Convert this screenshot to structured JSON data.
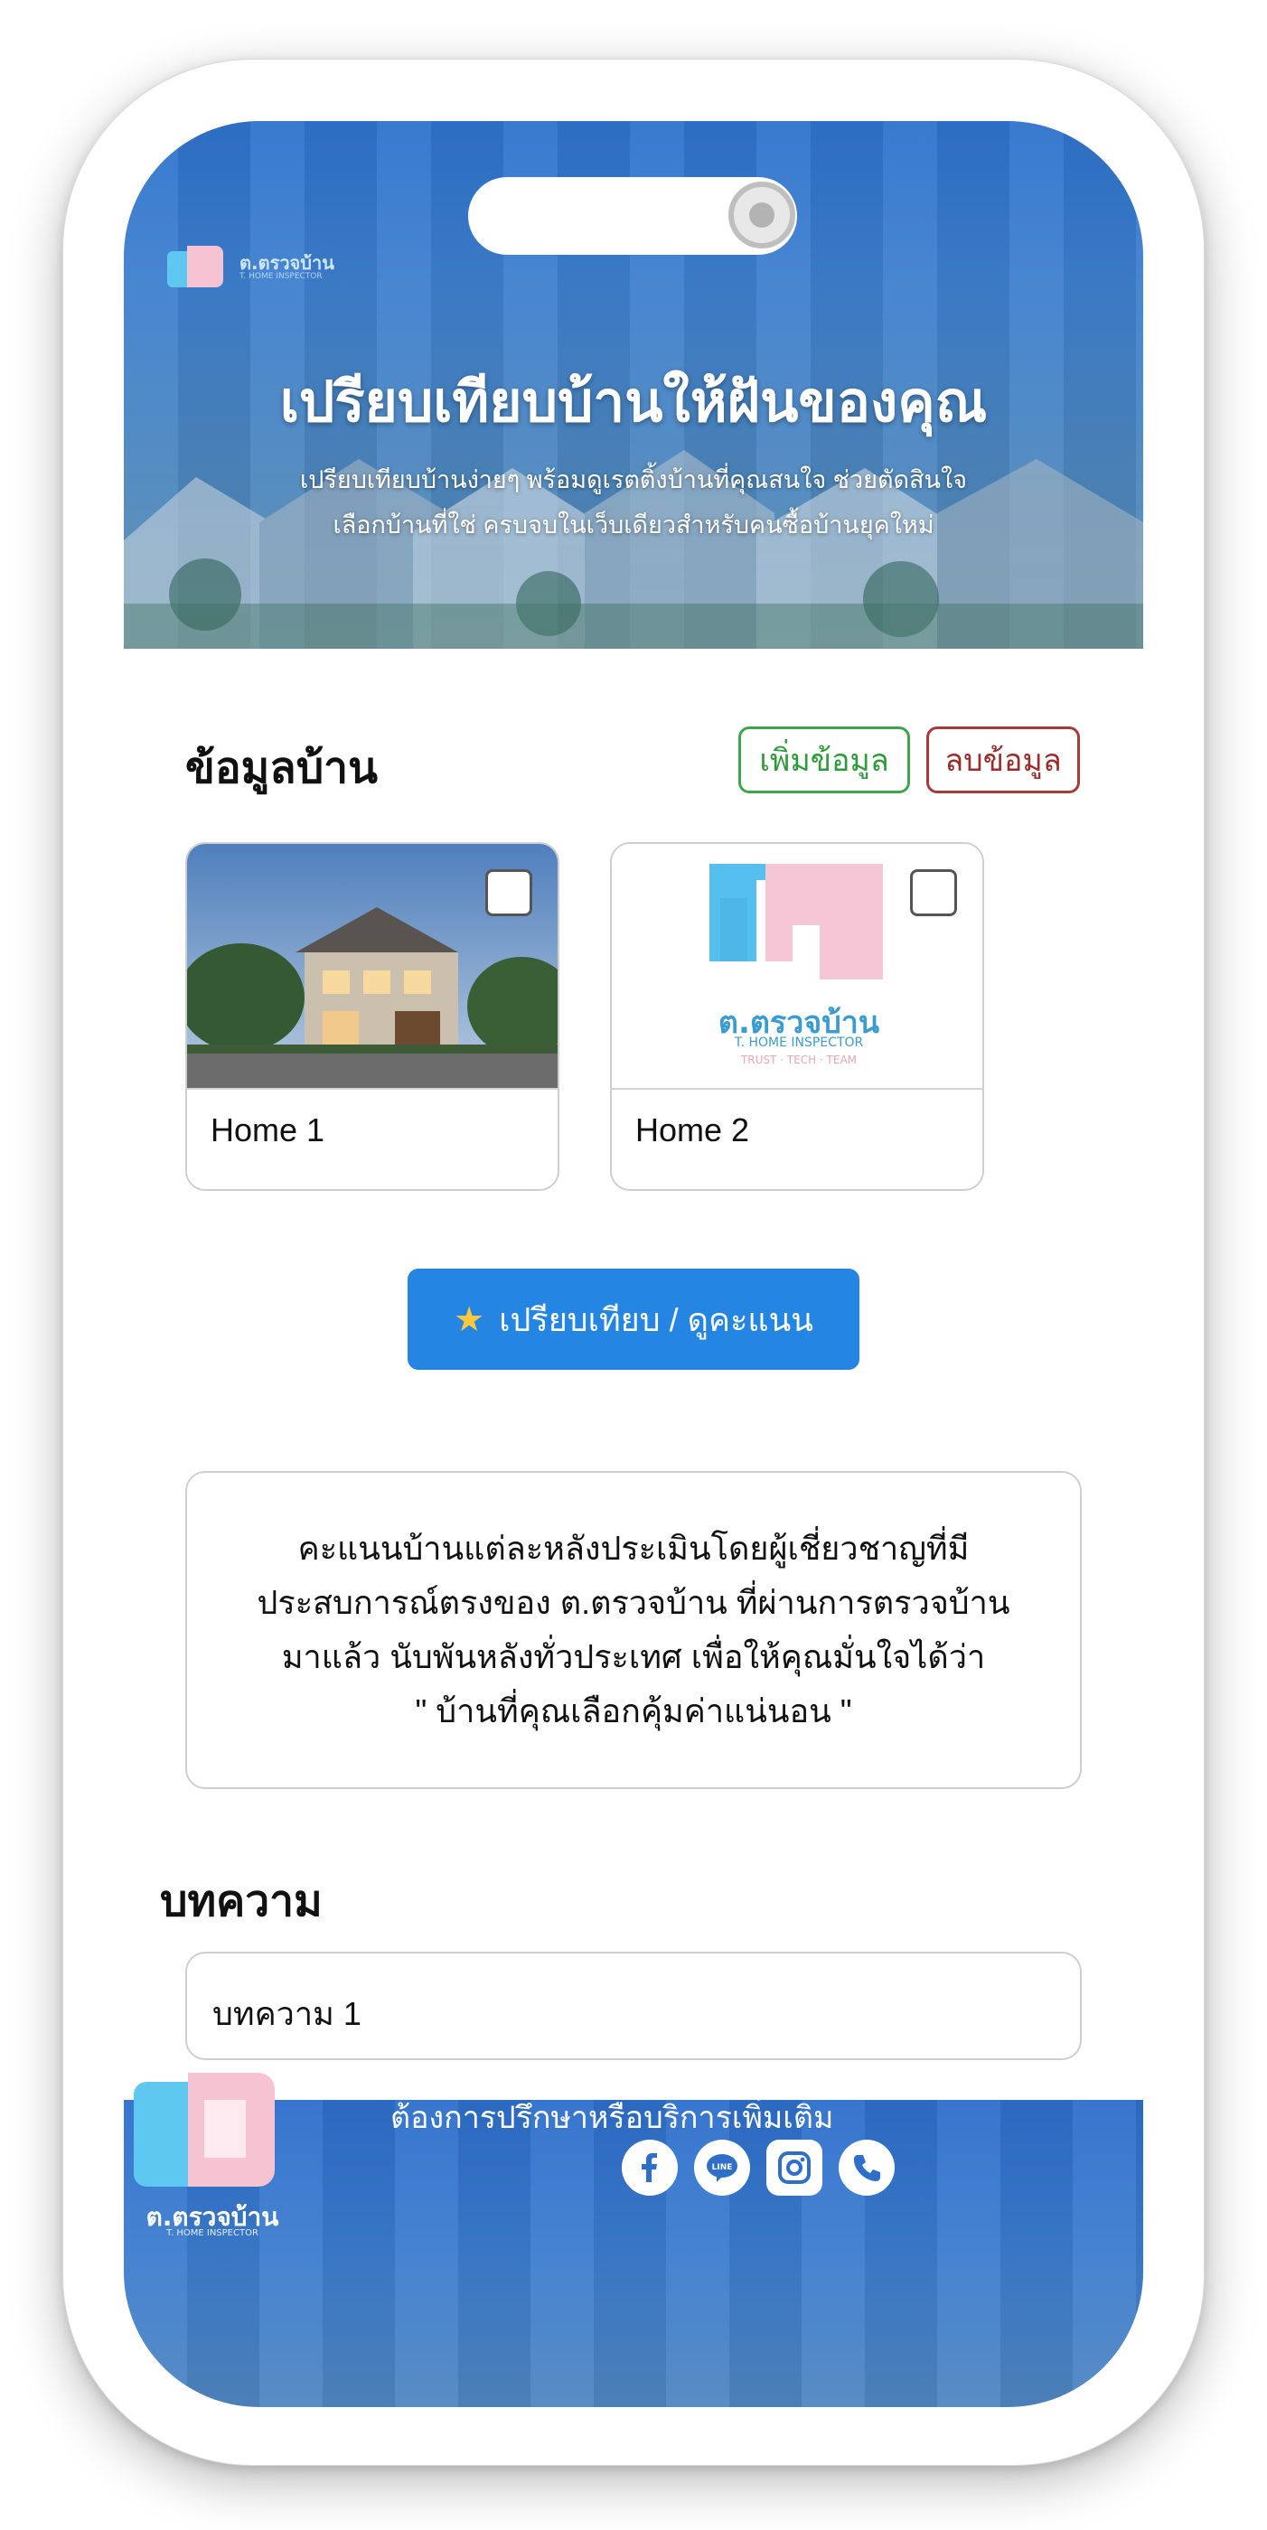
{
  "hero": {
    "brand_name": "ต.ตรวจบ้าน",
    "brand_sub": "T. HOME INSPECTOR",
    "title": "เปรียบเทียบบ้านให้ฝันของคุณ",
    "description_line1": "เปรียบเทียบบ้านง่ายๆ พร้อมดูเรตติ้งบ้านที่คุณสนใจ ช่วยตัดสินใจ",
    "description_line2": "เลือกบ้านที่ใช่ ครบจบในเว็บเดียวสำหรับคนซื้อบ้านยุคใหม่"
  },
  "homes_section": {
    "title": "ข้อมูลบ้าน",
    "add_label": "เพิ่มข้อมูล",
    "delete_label": "ลบข้อมูล",
    "cards": [
      {
        "label": "Home 1",
        "checked": false
      },
      {
        "label": "Home 2",
        "checked": false,
        "logo_text": "ต.ตรวจบ้าน",
        "logo_sub": "T. HOME INSPECTOR",
        "logo_tag": "TRUST · TECH · TEAM"
      }
    ]
  },
  "compare_button": {
    "label": "เปรียบเทียบ / ดูคะแนน",
    "icon": "star-icon"
  },
  "info_box": {
    "line1": "คะแนนบ้านแต่ละหลังประเมินโดยผู้เชี่ยวชาญที่มี",
    "line2": "ประสบการณ์ตรงของ ต.ตรวจบ้าน ที่ผ่านการตรวจบ้าน",
    "line3": "มาแล้ว นับพันหลังทั่วประเทศ เพื่อให้คุณมั่นใจได้ว่า",
    "line4": "\" บ้านที่คุณเลือกคุ้มค่าแน่นอน \""
  },
  "articles_section": {
    "title": "บทความ",
    "items": [
      {
        "label": "บทความ 1"
      }
    ]
  },
  "footer": {
    "brand_name": "ต.ตรวจบ้าน",
    "brand_sub": "T. HOME INSPECTOR",
    "contact_text": "ต้องการปรึกษาหรือบริการเพิ่มเติม",
    "social": [
      "facebook-icon",
      "line-icon",
      "instagram-icon",
      "phone-icon"
    ]
  },
  "colors": {
    "primary": "#2585e3",
    "add_green": "#3fa44a",
    "delete_red": "#a53b3b",
    "hero_blue": "#2f73cc"
  }
}
